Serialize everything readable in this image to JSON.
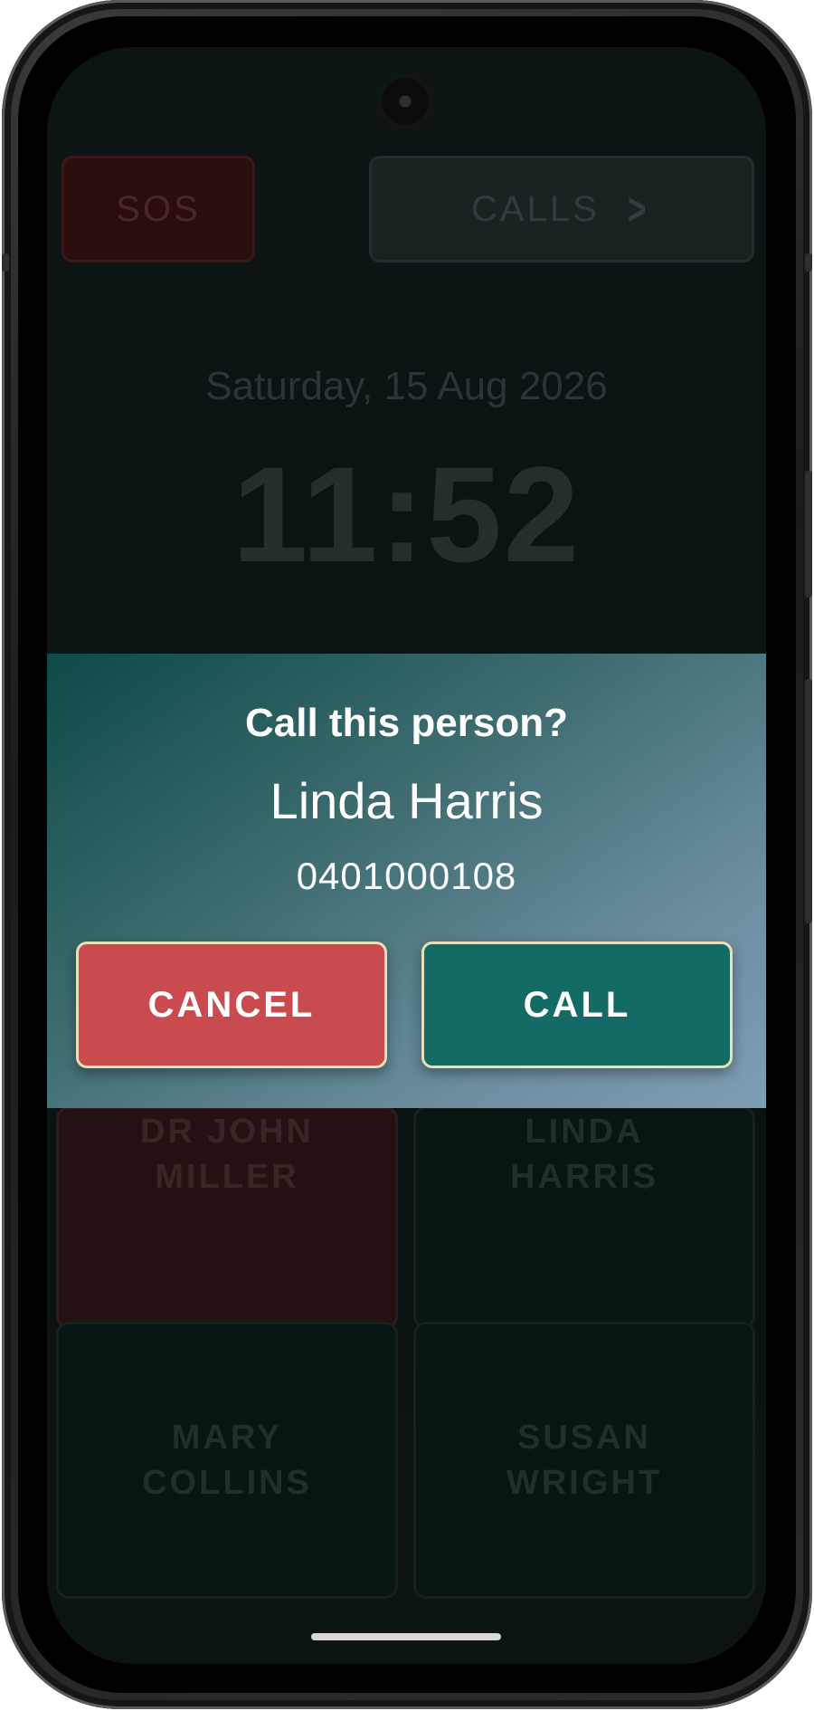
{
  "home": {
    "sos_label": "SOS",
    "calls_label": "CALLS",
    "date": "Saturday, 15 Aug 2026",
    "time": "11:52",
    "contacts": [
      {
        "name": "DR JOHN\nMILLER"
      },
      {
        "name": "LINDA\nHARRIS"
      },
      {
        "name": "MARY\nCOLLINS"
      },
      {
        "name": "SUSAN\nWRIGHT"
      }
    ]
  },
  "dialog": {
    "title": "Call this person?",
    "contact_name": "Linda Harris",
    "phone_number": "0401000108",
    "cancel_label": "CANCEL",
    "call_label": "CALL"
  },
  "icons": {
    "calls_arrow": "chevron-right-icon",
    "camera": "front-camera-icon"
  },
  "colors": {
    "cancel": "#c94b50",
    "call": "#146b66",
    "sos": "#2a0e0e"
  }
}
